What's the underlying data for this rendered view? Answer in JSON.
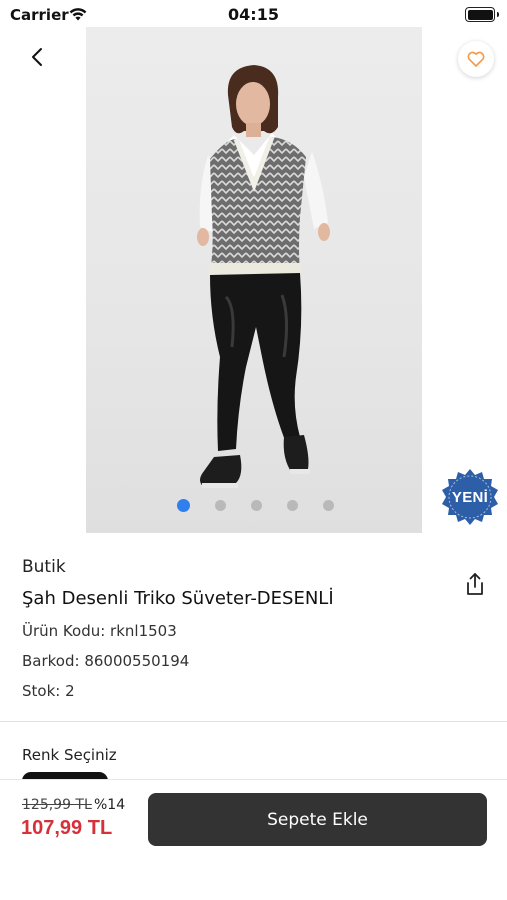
{
  "status_bar": {
    "carrier": "Carrier",
    "time": "04:15"
  },
  "product": {
    "brand": "Butik",
    "title": "Şah Desenli Triko Süveter-DESENLİ",
    "code_label": "Ürün Kodu: rknl1503",
    "barcode_label": "Barkod: 86000550194",
    "stock_label": "Stok: 2",
    "badge": "YENİ",
    "image_count": 5,
    "active_image": 1
  },
  "color_section": {
    "title": "Renk Seçiniz"
  },
  "pricing": {
    "old_price": "125,99 TL",
    "discount": "%14",
    "price": "107,99 TL",
    "add_to_cart": "Sepete Ekle"
  },
  "colors": {
    "accent_blue": "#2f80ed",
    "price_red": "#d6303b",
    "button_dark": "#333333",
    "badge_blue": "#2d5ea8"
  }
}
